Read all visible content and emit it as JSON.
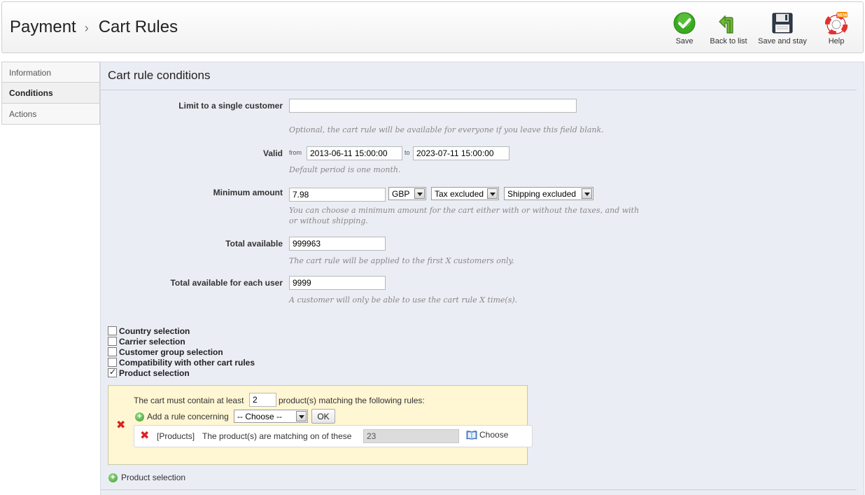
{
  "header": {
    "breadcrumb_parent": "Payment",
    "breadcrumb_current": "Cart Rules",
    "toolbar": {
      "save": "Save",
      "back": "Back to list",
      "save_stay": "Save and stay",
      "help": "Help",
      "help_badge": "NEW"
    }
  },
  "tabs": [
    "Information",
    "Conditions",
    "Actions"
  ],
  "panel": {
    "title": "Cart rule conditions",
    "limit_customer": {
      "label": "Limit to a single customer",
      "value": "",
      "hint": "Optional, the cart rule will be available for everyone if you leave this field blank."
    },
    "valid": {
      "label": "Valid",
      "from_label": "from",
      "from_value": "2013-06-11 15:00:00",
      "to_label": "to",
      "to_value": "2023-07-11 15:00:00",
      "hint": "Default period is one month."
    },
    "min_amount": {
      "label": "Minimum amount",
      "value": "7.98",
      "currency": "GBP",
      "tax": "Tax excluded",
      "shipping": "Shipping excluded",
      "hint_line1": "You can choose a minimum amount for the cart either with or without the taxes, and with",
      "hint_line2": "or without shipping."
    },
    "total_available": {
      "label": "Total available",
      "value": "999963",
      "hint": "The cart rule will be applied to the first X customers only."
    },
    "total_per_user": {
      "label": "Total available for each user",
      "value": "9999",
      "hint": "A customer will only be able to use the cart rule X time(s)."
    },
    "checkboxes": [
      {
        "label": "Country selection",
        "checked": false
      },
      {
        "label": "Carrier selection",
        "checked": false
      },
      {
        "label": "Customer group selection",
        "checked": false
      },
      {
        "label": "Compatibility with other cart rules",
        "checked": false
      },
      {
        "label": "Product selection",
        "checked": true
      }
    ],
    "product_rule": {
      "must_contain": "The cart must contain at least",
      "quantity": "2",
      "matching": "product(s) matching the following rules:",
      "add_rule": "Add a rule concerning",
      "choose_option": "-- Choose --",
      "ok": "OK",
      "rule_type": "[Products]",
      "rule_text": "The product(s) are matching on of these",
      "rule_value": "23",
      "choose_btn": "Choose"
    },
    "add_product_selection": "Product selection"
  },
  "colors": {
    "panel_bg": "#ebedf4",
    "rule_box_bg": "#fff6d3",
    "save_green": "#3aaa1f",
    "remove_red": "#dd2222"
  }
}
